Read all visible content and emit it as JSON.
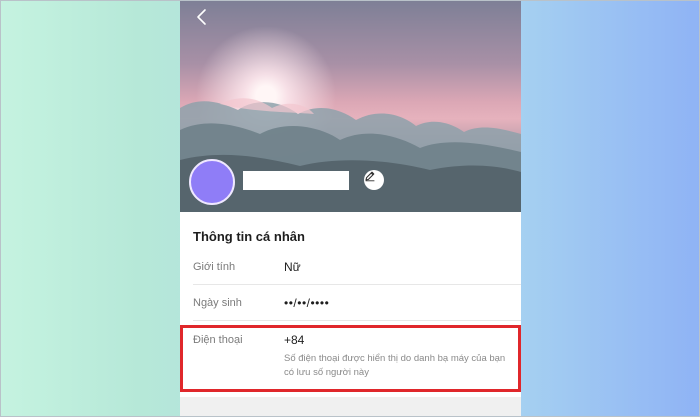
{
  "app": {
    "back_icon": "chevron-left-icon",
    "edit_icon": "pencil-icon",
    "avatar_color": "#8f7df7",
    "highlight_color": "#e0272b"
  },
  "info": {
    "section_title": "Thông tin cá nhân",
    "gender": {
      "label": "Giới tính",
      "value": "Nữ"
    },
    "birthday": {
      "label": "Ngày sinh",
      "value": "••/••/••••"
    },
    "phone": {
      "label": "Điện thoại",
      "value": "+84",
      "note": "Số điện thoại được hiển thị do danh bạ máy của bạn có lưu số người này"
    }
  }
}
